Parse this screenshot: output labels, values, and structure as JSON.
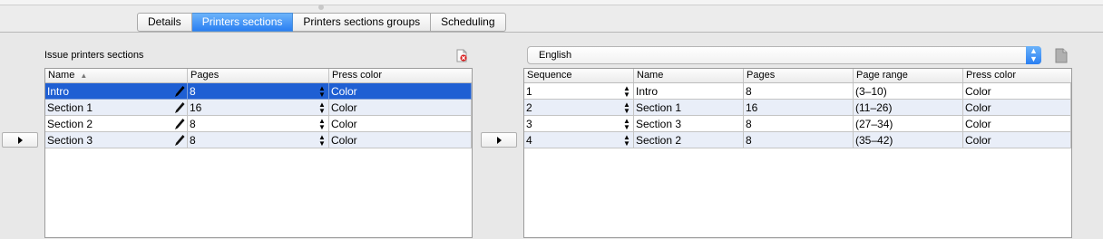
{
  "tabs": [
    {
      "label": "Details",
      "active": false
    },
    {
      "label": "Printers sections",
      "active": true
    },
    {
      "label": "Printers sections groups",
      "active": false
    },
    {
      "label": "Scheduling",
      "active": false
    }
  ],
  "left_panel": {
    "title": "Issue printers sections",
    "delete_icon": "delete-document-icon",
    "columns": [
      "Name",
      "Pages",
      "Press color"
    ],
    "sorted_column": "Name",
    "rows": [
      {
        "name": "Intro",
        "pages": "8",
        "press_color": "Color",
        "selected": true
      },
      {
        "name": "Section 1",
        "pages": "16",
        "press_color": "Color",
        "selected": false
      },
      {
        "name": "Section 2",
        "pages": "8",
        "press_color": "Color",
        "selected": false
      },
      {
        "name": "Section 3",
        "pages": "8",
        "press_color": "Color",
        "selected": false
      }
    ]
  },
  "right_panel": {
    "language_select": {
      "value": "English"
    },
    "doc_icon": "document-icon",
    "columns": [
      "Sequence",
      "Name",
      "Pages",
      "Page range",
      "Press color"
    ],
    "rows": [
      {
        "sequence": "1",
        "name": "Intro",
        "pages": "8",
        "page_range": "(3–10)",
        "press_color": "Color"
      },
      {
        "sequence": "2",
        "name": "Section 1",
        "pages": "16",
        "page_range": "(11–26)",
        "press_color": "Color"
      },
      {
        "sequence": "3",
        "name": "Section 3",
        "pages": "8",
        "page_range": "(27–34)",
        "press_color": "Color"
      },
      {
        "sequence": "4",
        "name": "Section 2",
        "pages": "8",
        "page_range": "(35–42)",
        "press_color": "Color"
      }
    ]
  },
  "colors": {
    "selection": "#1f5fd3",
    "accent": "#2a7ff2",
    "stripe": "#e9eef8"
  }
}
